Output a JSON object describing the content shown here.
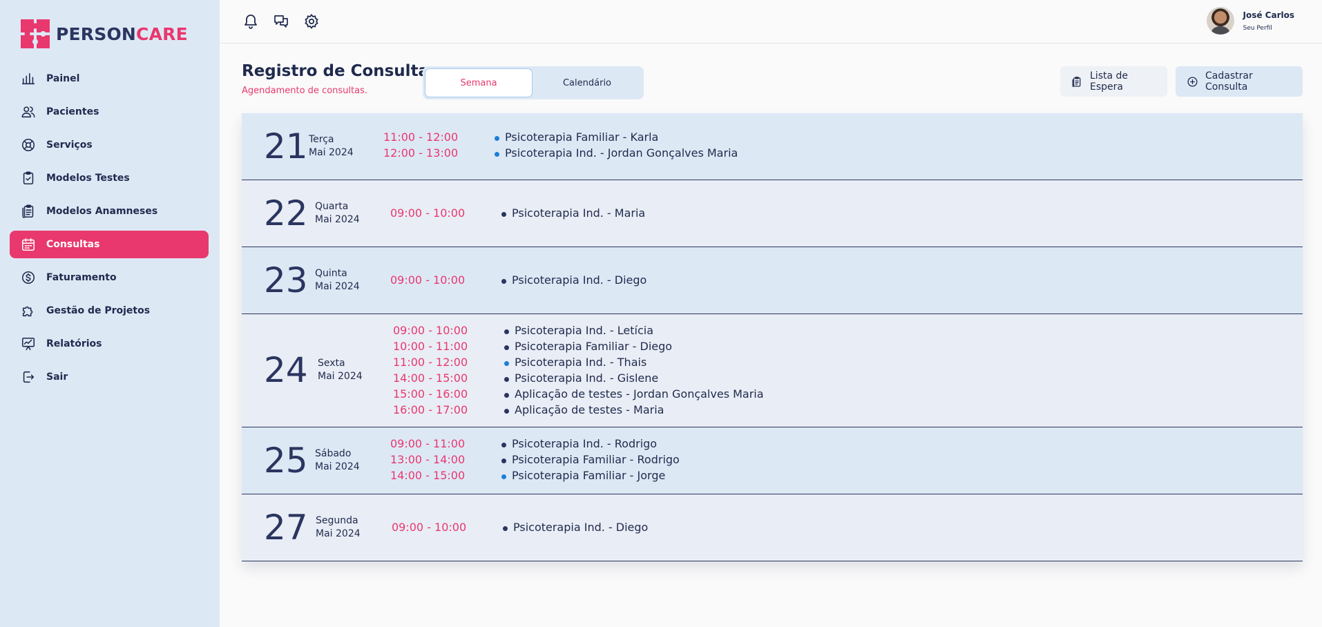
{
  "brand": {
    "part1": "PERSON",
    "part2": "CARE"
  },
  "nav": [
    {
      "label": "Painel",
      "icon": "chart-bars-icon",
      "active": false
    },
    {
      "label": "Pacientes",
      "icon": "users-icon",
      "active": false
    },
    {
      "label": "Serviços",
      "icon": "lifebuoy-icon",
      "active": false
    },
    {
      "label": "Modelos Testes",
      "icon": "clipboard-check-icon",
      "active": false
    },
    {
      "label": "Modelos Anamneses",
      "icon": "clipboard-list-icon",
      "active": false
    },
    {
      "label": "Consultas",
      "icon": "calendar-icon",
      "active": true
    },
    {
      "label": "Faturamento",
      "icon": "dollar-circle-icon",
      "active": false
    },
    {
      "label": "Gestão de Projetos",
      "icon": "puzzle-icon",
      "active": false
    },
    {
      "label": "Relatórios",
      "icon": "presentation-chart-icon",
      "active": false
    },
    {
      "label": "Sair",
      "icon": "logout-icon",
      "active": false
    }
  ],
  "topbar": {
    "icons": [
      "bell-icon",
      "chat-icon",
      "gear-icon"
    ],
    "profile": {
      "name": "José Carlos",
      "subtitle": "Seu Perfil"
    }
  },
  "header": {
    "title": "Registro de Consultas",
    "subtitle": "Agendamento de consultas.",
    "toggle": {
      "week": "Semana",
      "calendar": "Calendário"
    },
    "waitlist": "Lista de Espera",
    "add": "Cadastrar Consulta"
  },
  "colors": {
    "accent": "#e8386e",
    "navy": "#2a3560",
    "sidebar": "#dde8f5",
    "dot_blue": "#1a7fd6"
  },
  "days": [
    {
      "day": "21",
      "weekday": "Terça",
      "month": "Mai 2024",
      "shade": "blue",
      "appointments": [
        {
          "time": "11:00 - 12:00",
          "title": "Psicoterapia Familiar - Karla",
          "dot": "blue"
        },
        {
          "time": "12:00 - 13:00",
          "title": "Psicoterapia Ind. - Jordan Gonçalves Maria",
          "dot": "blue"
        }
      ]
    },
    {
      "day": "22",
      "weekday": "Quarta",
      "month": "Mai 2024",
      "shade": "grey",
      "appointments": [
        {
          "time": "09:00 - 10:00",
          "title": "Psicoterapia Ind. - Maria",
          "dot": "navy"
        }
      ]
    },
    {
      "day": "23",
      "weekday": "Quinta",
      "month": "Mai 2024",
      "shade": "blue",
      "appointments": [
        {
          "time": "09:00 - 10:00",
          "title": "Psicoterapia Ind. - Diego",
          "dot": "navy"
        }
      ]
    },
    {
      "day": "24",
      "weekday": "Sexta",
      "month": "Mai 2024",
      "shade": "grey",
      "appointments": [
        {
          "time": "09:00 - 10:00",
          "title": "Psicoterapia Ind. - Letícia",
          "dot": "navy"
        },
        {
          "time": "10:00 - 11:00",
          "title": "Psicoterapia Familiar - Diego",
          "dot": "navy"
        },
        {
          "time": "11:00 - 12:00",
          "title": "Psicoterapia Ind. - Thais",
          "dot": "blue"
        },
        {
          "time": "14:00 - 15:00",
          "title": "Psicoterapia Ind. - Gislene",
          "dot": "navy"
        },
        {
          "time": "15:00 - 16:00",
          "title": "Aplicação de testes - Jordan Gonçalves Maria",
          "dot": "navy"
        },
        {
          "time": "16:00 - 17:00",
          "title": "Aplicação de testes - Maria",
          "dot": "navy"
        }
      ]
    },
    {
      "day": "25",
      "weekday": "Sábado",
      "month": "Mai 2024",
      "shade": "blue",
      "appointments": [
        {
          "time": "09:00 - 11:00",
          "title": "Psicoterapia Ind. - Rodrigo",
          "dot": "navy"
        },
        {
          "time": "13:00 - 14:00",
          "title": "Psicoterapia Familiar - Rodrigo",
          "dot": "navy"
        },
        {
          "time": "14:00 - 15:00",
          "title": "Psicoterapia Familiar - Jorge",
          "dot": "blue"
        }
      ]
    },
    {
      "day": "27",
      "weekday": "Segunda",
      "month": "Mai 2024",
      "shade": "grey",
      "appointments": [
        {
          "time": "09:00 - 10:00",
          "title": "Psicoterapia Ind. - Diego",
          "dot": "navy"
        }
      ]
    }
  ]
}
